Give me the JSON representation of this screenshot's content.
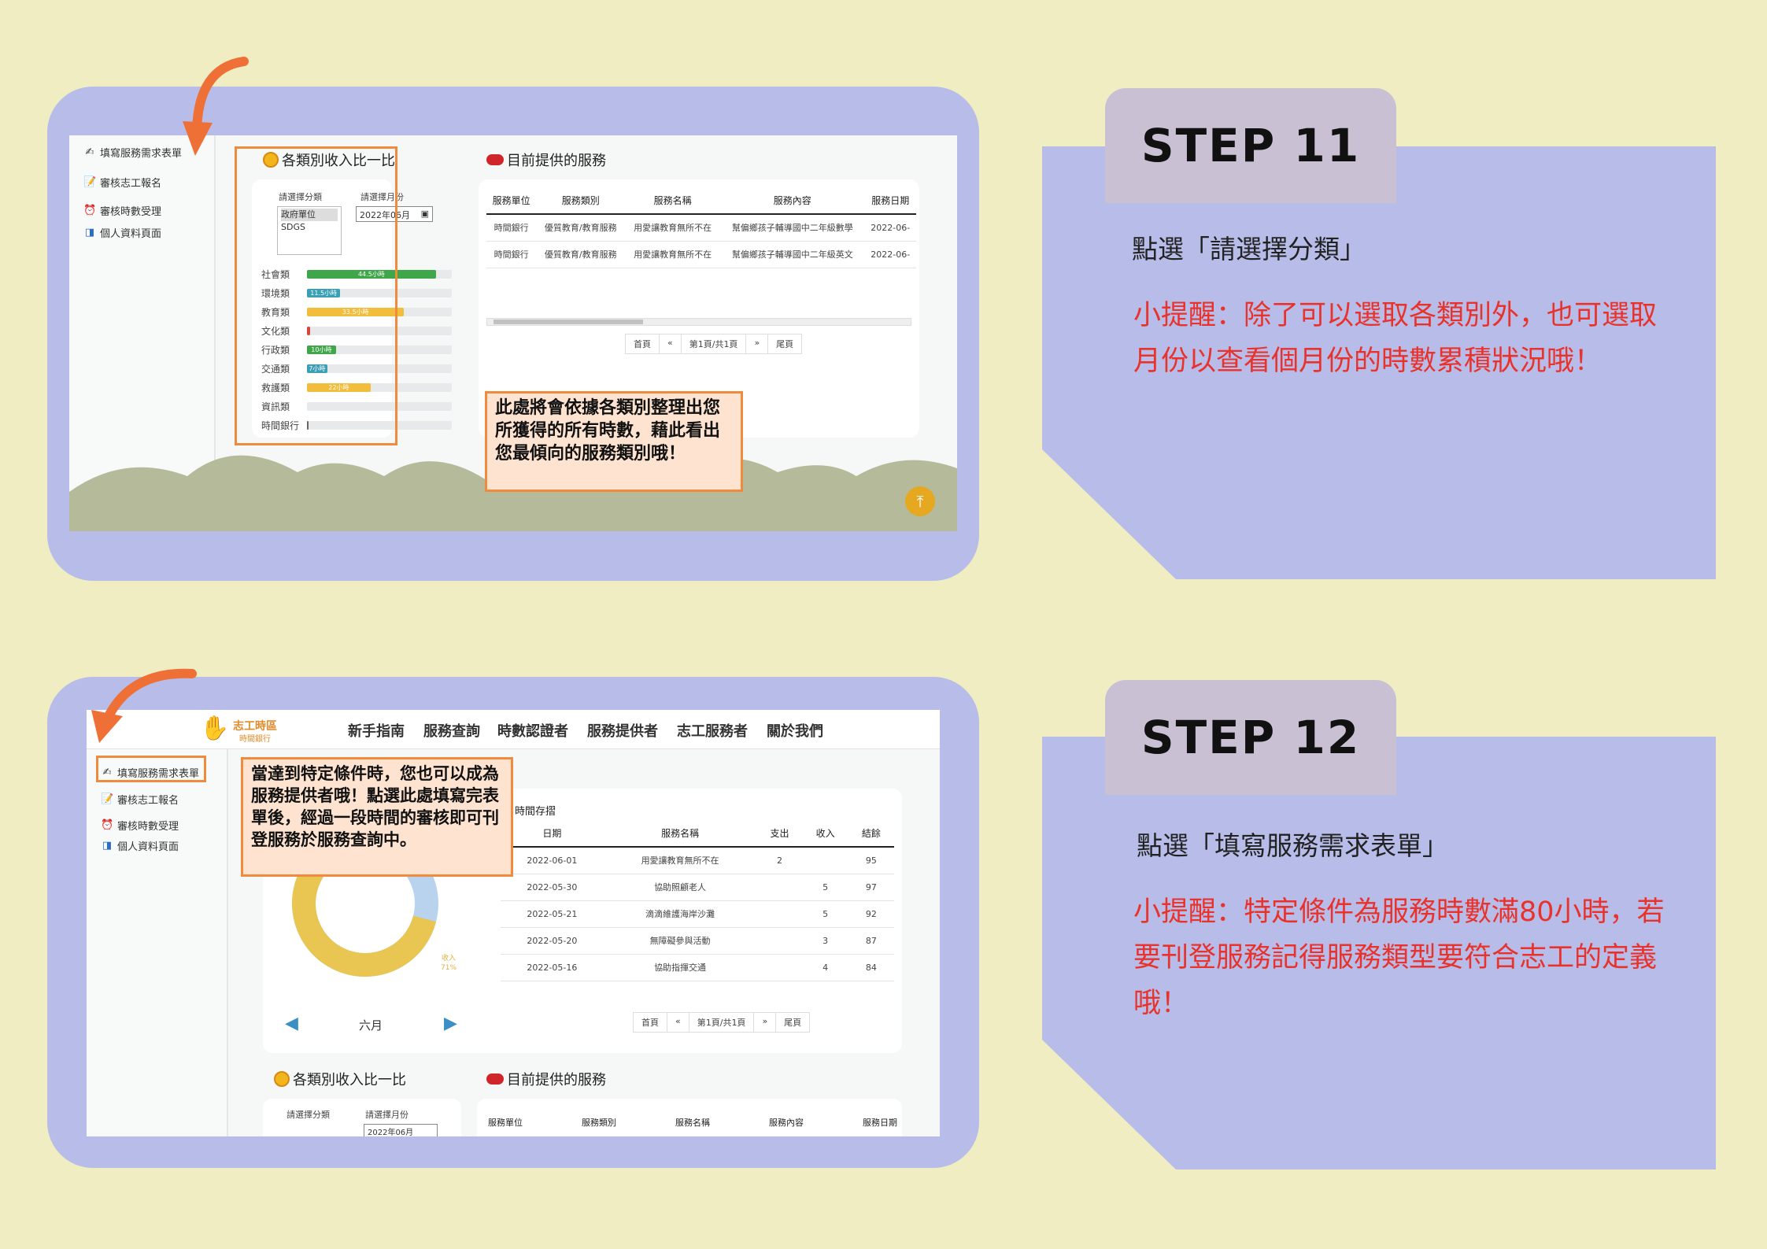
{
  "steps": [
    {
      "label": "STEP 11",
      "instruction": "點選「請選擇分類」",
      "tip": "小提醒：除了可以選取各類別外，也可選取月份以查看個月份的時數累積狀況哦！"
    },
    {
      "label": "STEP 12",
      "instruction": "點選「填寫服務需求表單」",
      "tip": "小提醒：特定條件為服務時數滿80小時，若要刊登服務記得服務類型要符合志工的定義哦！"
    }
  ],
  "sidebar": {
    "items": [
      {
        "label": "填寫服務需求表單",
        "icon": "pencil-icon"
      },
      {
        "label": "審核志工報名",
        "icon": "document-icon"
      },
      {
        "label": "審核時數受理",
        "icon": "alarm-clock-icon"
      },
      {
        "label": "個人資料頁面",
        "icon": "profile-icon"
      }
    ]
  },
  "screen1": {
    "category_section_title": "各類別收入比一比",
    "category_select_label": "請選擇分類",
    "month_select_label": "請選擇月份",
    "category_options": [
      "政府單位",
      "SDGS"
    ],
    "month_value": "2022年06月",
    "bars": [
      {
        "label": "社會類",
        "value_label": "44.5小時",
        "fraction": 0.89,
        "color": "#3fa64a"
      },
      {
        "label": "環境類",
        "value_label": "11.5小時",
        "fraction": 0.23,
        "color": "#3b9fb5"
      },
      {
        "label": "教育類",
        "value_label": "33.5小時",
        "fraction": 0.67,
        "color": "#f2bc3d"
      },
      {
        "label": "文化類",
        "value_label": "",
        "fraction": 0.02,
        "color": "#d9433a"
      },
      {
        "label": "行政類",
        "value_label": "10小時",
        "fraction": 0.2,
        "color": "#3fa64a"
      },
      {
        "label": "交通類",
        "value_label": "7小時",
        "fraction": 0.14,
        "color": "#3b9fb5"
      },
      {
        "label": "救護類",
        "value_label": "22小時",
        "fraction": 0.44,
        "color": "#f2bc3d"
      },
      {
        "label": "資訊類",
        "value_label": "",
        "fraction": 0,
        "color": "#3b9fb5"
      },
      {
        "label": "時間銀行",
        "value_label": "",
        "fraction": 0.01,
        "color": "#666666"
      }
    ],
    "services_title": "目前提供的服務",
    "services_headers": [
      "服務單位",
      "服務類別",
      "服務名稱",
      "服務內容",
      "服務日期"
    ],
    "services_rows": [
      [
        "時間銀行",
        "優質教育/教育服務",
        "用愛讓教育無所不在",
        "幫偏鄉孩子輔導國中二年級數學",
        "2022-06-"
      ],
      [
        "時間銀行",
        "優質教育/教育服務",
        "用愛讓教育無所不在",
        "幫偏鄉孩子輔導國中二年級英文",
        "2022-06-"
      ]
    ],
    "pager": [
      "首頁",
      "«",
      "第1頁/共1頁",
      "»",
      "尾頁"
    ],
    "note": "此處將會依據各類別整理出您所獲得的所有時數，藉此看出您最傾向的服務類別哦！"
  },
  "screen2": {
    "logo_text": "志工時區",
    "logo_sub": "時間銀行",
    "nav": [
      "新手指南",
      "服務查詢",
      "時數認證者",
      "服務提供者",
      "志工服務者",
      "關於我們"
    ],
    "note": "當達到特定條件時，您也可以成為服務提供者哦！點選此處填寫完表單後，經過一段時間的審核即可刊登服務於服務查詢中。",
    "history_title": "時間存摺",
    "history_headers": [
      "日期",
      "服務名稱",
      "支出",
      "收入",
      "結餘"
    ],
    "history_rows": [
      [
        "2022-06-01",
        "用愛讓教育無所不在",
        "2",
        "",
        "95"
      ],
      [
        "2022-05-30",
        "協助照顧老人",
        "",
        "5",
        "97"
      ],
      [
        "2022-05-21",
        "滴滴維護海岸沙灘",
        "",
        "5",
        "92"
      ],
      [
        "2022-05-20",
        "無障礙參與活動",
        "",
        "3",
        "87"
      ],
      [
        "2022-05-16",
        "協助指揮交通",
        "",
        "4",
        "84"
      ]
    ],
    "donut_income_label": "收入",
    "donut_income_pct": "71%",
    "donut_income_fraction": 0.71,
    "month_label": "六月",
    "pager": [
      "首頁",
      "«",
      "第1頁/共1頁",
      "»",
      "尾頁"
    ],
    "category_section_title": "各類別收入比一比",
    "services_title": "目前提供的服務",
    "category_select_label": "請選擇分類",
    "month_select_label": "請選擇月份",
    "month_value": "2022年06月",
    "services_headers": [
      "服務單位",
      "服務類別",
      "服務名稱",
      "服務內容",
      "服務日期"
    ]
  },
  "colors": {
    "background": "#f0edc3",
    "frame": "#b7bde8",
    "tab": "#c9c0d4",
    "tip": "#e8322b",
    "highlight": "#f08a3c",
    "donut_income": "#e9c552",
    "donut_expense": "#b9d3ee"
  }
}
